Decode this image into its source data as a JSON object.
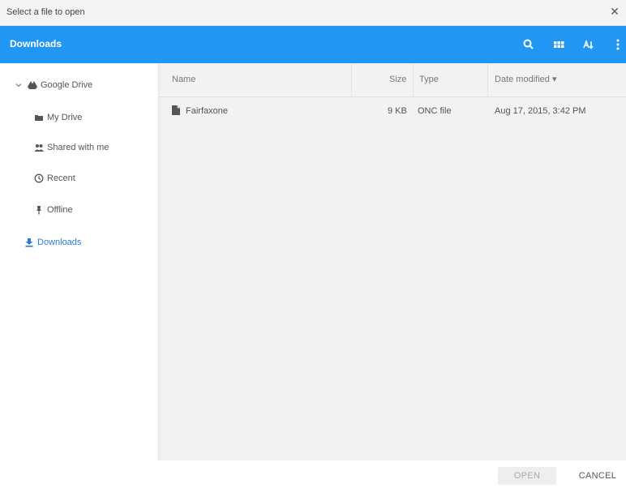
{
  "dialog": {
    "title": "Select a file to open",
    "close_glyph": "✕"
  },
  "toolbar": {
    "location": "Downloads",
    "icons": [
      "search-icon",
      "grid-view-icon",
      "sort-icon",
      "more-vert-icon"
    ],
    "accent_color": "#2196f3"
  },
  "sidebar": {
    "items": [
      {
        "label": "Google Drive",
        "icon": "google-drive-icon",
        "expanded": true
      },
      {
        "label": "My Drive",
        "icon": "folder-icon"
      },
      {
        "label": "Shared with me",
        "icon": "people-icon"
      },
      {
        "label": "Recent",
        "icon": "clock-icon"
      },
      {
        "label": "Offline",
        "icon": "pin-icon"
      },
      {
        "label": "Downloads",
        "icon": "download-icon",
        "active": true
      }
    ],
    "active_color": "#2b7bd6"
  },
  "file_list": {
    "columns": [
      "Name",
      "Size",
      "Type",
      "Date modified"
    ],
    "sort_indicator": "▾",
    "rows": [
      {
        "name": "Fairfaxone",
        "size": "9 KB",
        "type": "ONC file",
        "modified": "Aug 17, 2015, 3:42 PM",
        "icon": "file-icon"
      }
    ]
  },
  "footer": {
    "open_label": "OPEN",
    "cancel_label": "CANCEL",
    "open_enabled": false
  }
}
